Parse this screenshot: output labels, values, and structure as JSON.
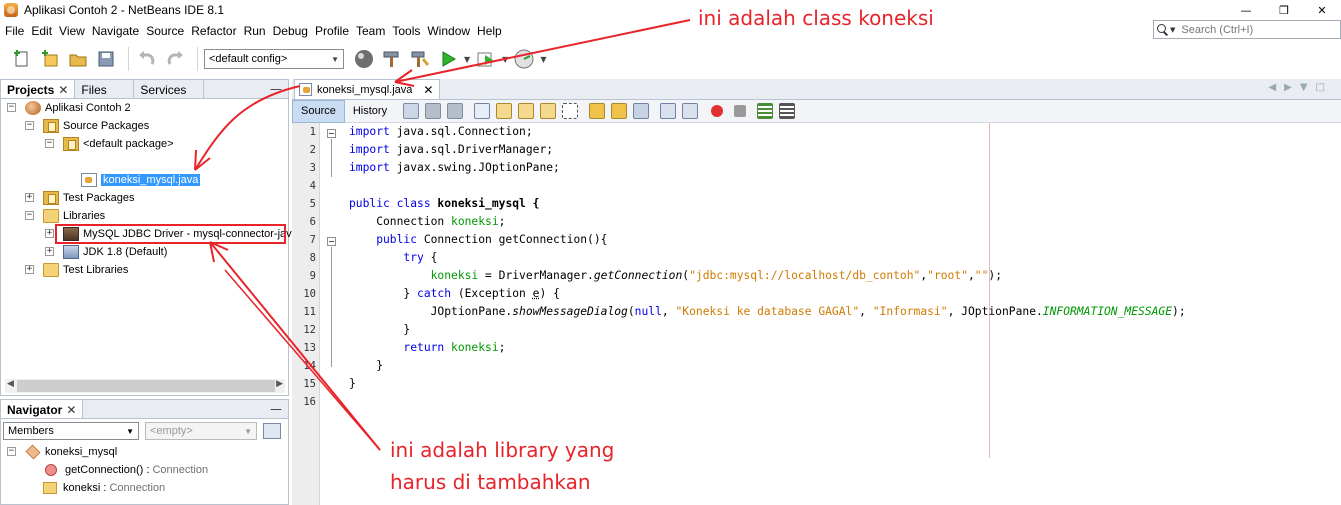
{
  "window": {
    "title": "Aplikasi Contoh 2 - NetBeans IDE 8.1",
    "controls": [
      "—",
      "❐",
      "✕"
    ]
  },
  "menu": [
    "File",
    "Edit",
    "View",
    "Navigate",
    "Source",
    "Refactor",
    "Run",
    "Debug",
    "Profile",
    "Team",
    "Tools",
    "Window",
    "Help"
  ],
  "search": {
    "placeholder": "Search (Ctrl+I)"
  },
  "toolbar": {
    "config_value": "<default config>"
  },
  "projects_panel": {
    "tabs": [
      "Projects",
      "Files",
      "Services"
    ],
    "tree": {
      "project": "Aplikasi Contoh 2",
      "source_packages": "Source Packages",
      "default_package": "<default package>",
      "selected_file": "koneksi_mysql.java",
      "test_packages": "Test Packages",
      "libraries": "Libraries",
      "mysql_driver": "MySQL JDBC Driver - mysql-connector-jav",
      "jdk": "JDK 1.8 (Default)",
      "test_libraries": "Test Libraries"
    }
  },
  "navigator": {
    "title": "Navigator",
    "filter_value": "Members",
    "empty_value": "<empty>",
    "class_name": "koneksi_mysql",
    "members": [
      {
        "name": "getConnection()",
        "sep": " : ",
        "type": "Connection"
      },
      {
        "name": "koneksi",
        "sep": " : ",
        "type": "Connection"
      }
    ]
  },
  "editor": {
    "tab_label": "koneksi_mysql.java",
    "view_tabs": [
      "Source",
      "History"
    ],
    "line_numbers": [
      "1",
      "2",
      "3",
      "4",
      "5",
      "6",
      "7",
      "8",
      "9",
      "10",
      "11",
      "12",
      "13",
      "14",
      "15",
      "16"
    ],
    "code": {
      "l1_kw": "import",
      "l1_rest": " java.sql.Connection;",
      "l2_kw": "import",
      "l2_rest": " java.sql.DriverManager;",
      "l3_kw": "import",
      "l3_rest": " javax.swing.JOptionPane;",
      "l5_kw1": "public",
      "l5_kw2": " class",
      "l5_rest": " koneksi_mysql {",
      "l6_a": "    Connection ",
      "l6_field": "koneksi",
      "l6_b": ";",
      "l7_kw": "    public",
      "l7_rest": " Connection getConnection(){",
      "l8_kw": "        try",
      "l8_rest": " {",
      "l9_indent": "            ",
      "l9_field": "koneksi",
      "l9_a": " = DriverManager.",
      "l9_method": "getConnection",
      "l9_b": "(",
      "l9_s1": "\"jdbc:mysql://localhost/db_contoh\"",
      "l9_c": ",",
      "l9_s2": "\"root\"",
      "l9_d": ",",
      "l9_s3": "\"\"",
      "l9_e": ");",
      "l10_a": "        } ",
      "l10_kw": "catch",
      "l10_b": " (Exception ",
      "l10_var": "e",
      "l10_c": ") {",
      "l11_a": "            JOptionPane.",
      "l11_method": "showMessageDialog",
      "l11_b": "(",
      "l11_kw": "null",
      "l11_c": ", ",
      "l11_s1": "\"Koneksi ke database GAGAl\"",
      "l11_d": ", ",
      "l11_s2": "\"Informasi\"",
      "l11_e": ", JOptionPane.",
      "l11_const": "INFORMATION_MESSAGE",
      "l11_f": ");",
      "l12": "        }",
      "l13_kw": "        return",
      "l13_sp": " ",
      "l13_field": "koneksi",
      "l13_b": ";",
      "l14": "    }",
      "l15": "}"
    }
  },
  "annotations": {
    "class_note": "ini adalah class koneksi",
    "library_note_line1": "ini adalah library yang",
    "library_note_line2": "harus di tambahkan"
  },
  "colors": {
    "annotation_red": "#e8232a",
    "keyword_blue": "#0000e6",
    "string_orange": "#ce7b00",
    "field_green": "#009900",
    "selection_blue": "#3399ff"
  }
}
